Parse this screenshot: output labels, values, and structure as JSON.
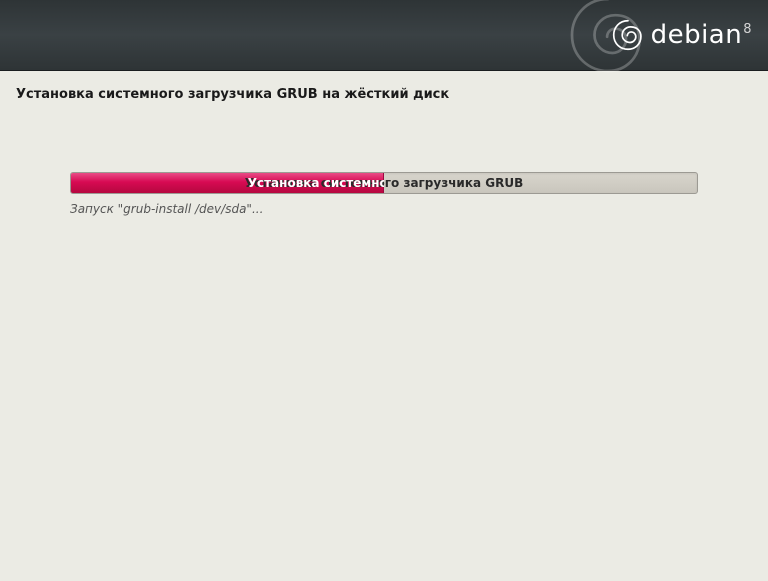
{
  "brand": {
    "name": "debian",
    "version": "8"
  },
  "page": {
    "title": "Установка системного загрузчика GRUB на жёсткий диск"
  },
  "progress": {
    "label": "Установка системного загрузчика GRUB",
    "percent": 50,
    "status": "Запуск \"grub-install /dev/sda\"..."
  }
}
